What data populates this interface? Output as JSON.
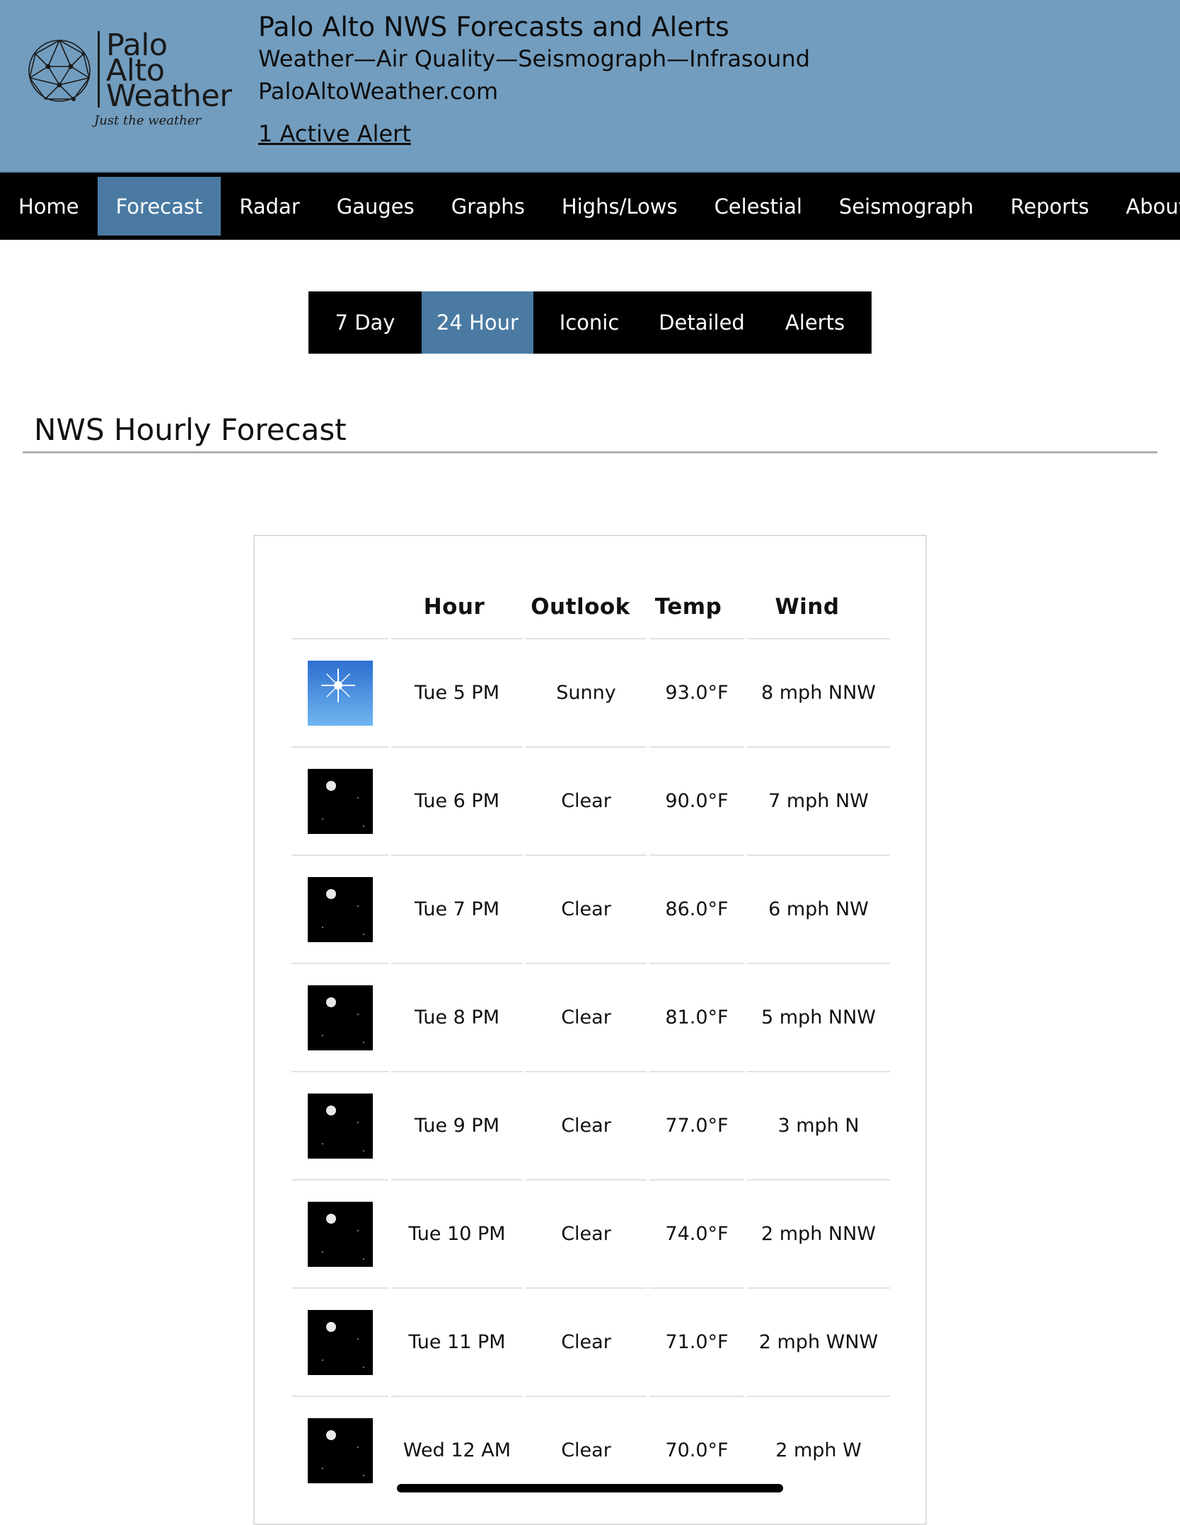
{
  "header": {
    "logo_lines": [
      "Palo",
      "Alto",
      "Weather"
    ],
    "logo_tagline": "Just the weather",
    "title": "Palo Alto NWS Forecasts and Alerts",
    "subtitle": "Weather—Air Quality—Seismograph—Infrasound",
    "site_url": "PaloAltoWeather.com",
    "alert_link": "1 Active Alert"
  },
  "nav": {
    "items": [
      {
        "label": "Home",
        "active": false
      },
      {
        "label": "Forecast",
        "active": true
      },
      {
        "label": "Radar",
        "active": false
      },
      {
        "label": "Gauges",
        "active": false
      },
      {
        "label": "Graphs",
        "active": false
      },
      {
        "label": "Highs/Lows",
        "active": false
      },
      {
        "label": "Celestial",
        "active": false
      },
      {
        "label": "Seismograph",
        "active": false
      },
      {
        "label": "Reports",
        "active": false
      },
      {
        "label": "About",
        "active": false
      }
    ]
  },
  "subnav": {
    "items": [
      {
        "label": "7 Day",
        "active": false
      },
      {
        "label": "24 Hour",
        "active": true
      },
      {
        "label": "Iconic",
        "active": false
      },
      {
        "label": "Detailed",
        "active": false
      },
      {
        "label": "Alerts",
        "active": false
      }
    ]
  },
  "page_title": "NWS Hourly Forecast",
  "table": {
    "headers": {
      "icon": "",
      "hour": "Hour",
      "outlook": "Outlook",
      "temp": "Temp",
      "wind": "Wind"
    },
    "rows": [
      {
        "icon": "sunny-icon",
        "hour": "Tue 5 PM",
        "outlook": "Sunny",
        "temp": "93.0°F",
        "wind": "8 mph NNW"
      },
      {
        "icon": "clear-night-icon",
        "hour": "Tue 6 PM",
        "outlook": "Clear",
        "temp": "90.0°F",
        "wind": "7 mph NW"
      },
      {
        "icon": "clear-night-icon",
        "hour": "Tue 7 PM",
        "outlook": "Clear",
        "temp": "86.0°F",
        "wind": "6 mph NW"
      },
      {
        "icon": "clear-night-icon",
        "hour": "Tue 8 PM",
        "outlook": "Clear",
        "temp": "81.0°F",
        "wind": "5 mph NNW"
      },
      {
        "icon": "clear-night-icon",
        "hour": "Tue 9 PM",
        "outlook": "Clear",
        "temp": "77.0°F",
        "wind": "3 mph N"
      },
      {
        "icon": "clear-night-icon",
        "hour": "Tue 10 PM",
        "outlook": "Clear",
        "temp": "74.0°F",
        "wind": "2 mph NNW"
      },
      {
        "icon": "clear-night-icon",
        "hour": "Tue 11 PM",
        "outlook": "Clear",
        "temp": "71.0°F",
        "wind": "2 mph WNW"
      },
      {
        "icon": "clear-night-icon",
        "hour": "Wed 12 AM",
        "outlook": "Clear",
        "temp": "70.0°F",
        "wind": "2 mph W"
      }
    ]
  },
  "colors": {
    "header_bg": "#729dbf",
    "nav_bg": "#000000",
    "active_tab": "#4a7aa2"
  }
}
